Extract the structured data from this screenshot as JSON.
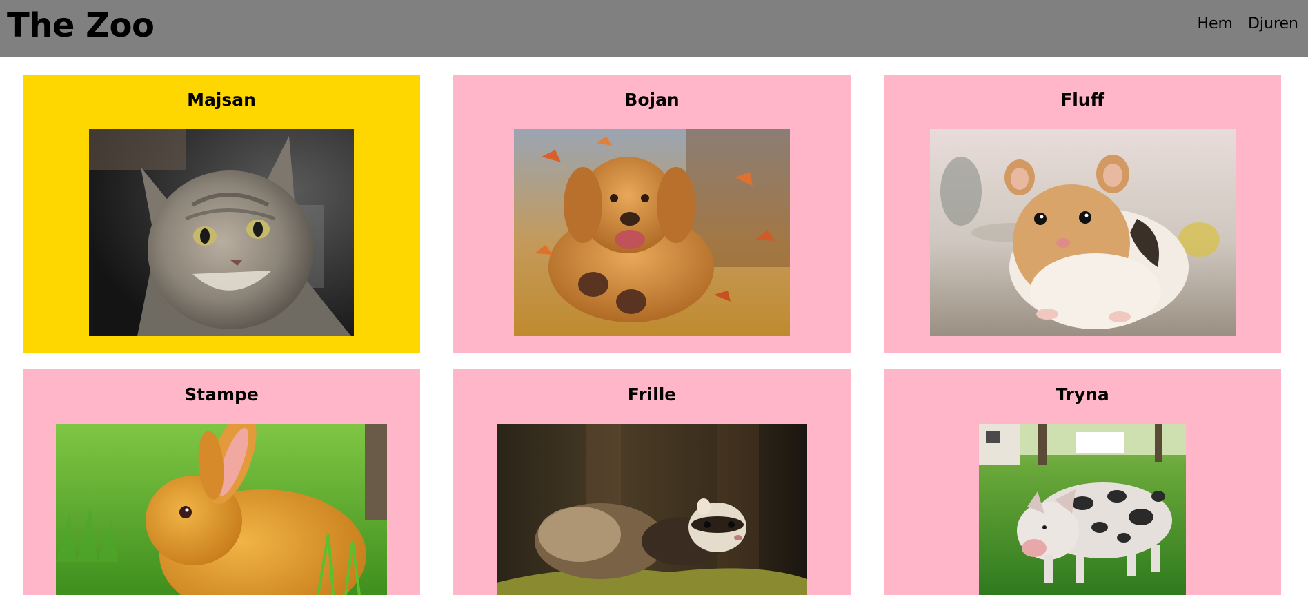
{
  "header": {
    "site_title": "The Zoo",
    "nav": [
      {
        "label": "Hem"
      },
      {
        "label": "Djuren"
      }
    ]
  },
  "colors": {
    "header_bg": "#808080",
    "card_selected": "#FFD700",
    "card_default": "#FFB6C8"
  },
  "animals": [
    {
      "name": "Majsan",
      "photo": "tabby-cat-photo",
      "selected": true
    },
    {
      "name": "Bojan",
      "photo": "golden-retriever-photo",
      "selected": false
    },
    {
      "name": "Fluff",
      "photo": "hamster-photo",
      "selected": false
    },
    {
      "name": "Stampe",
      "photo": "orange-rabbit-photo",
      "selected": false
    },
    {
      "name": "Frille",
      "photo": "ferret-photo",
      "selected": false
    },
    {
      "name": "Tryna",
      "photo": "spotted-pig-photo",
      "selected": false
    }
  ]
}
